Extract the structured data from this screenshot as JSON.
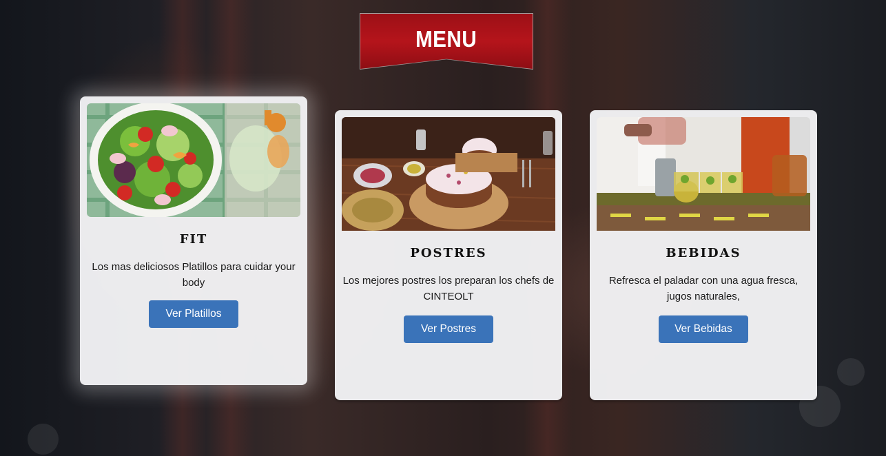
{
  "header": {
    "title": "MENU"
  },
  "cards": [
    {
      "title": "FIT",
      "description": "Los mas deliciosos Platillos para cuidar your body",
      "button_label": "Ver Platillos",
      "image": "salad-bowl-image"
    },
    {
      "title": "POSTRES",
      "description": "Los mejores postres los preparan los chefs de CINTEOLT",
      "button_label": "Ver Postres",
      "image": "cake-dessert-image"
    },
    {
      "title": "BEBIDAS",
      "description": "Refresca el paladar con una agua fresca, jugos naturales,",
      "button_label": "Ver Bebidas",
      "image": "drinks-bar-image"
    }
  ],
  "colors": {
    "ribbon": "#b5141b",
    "button": "#3a73b9",
    "card": "#f2f2f4"
  }
}
